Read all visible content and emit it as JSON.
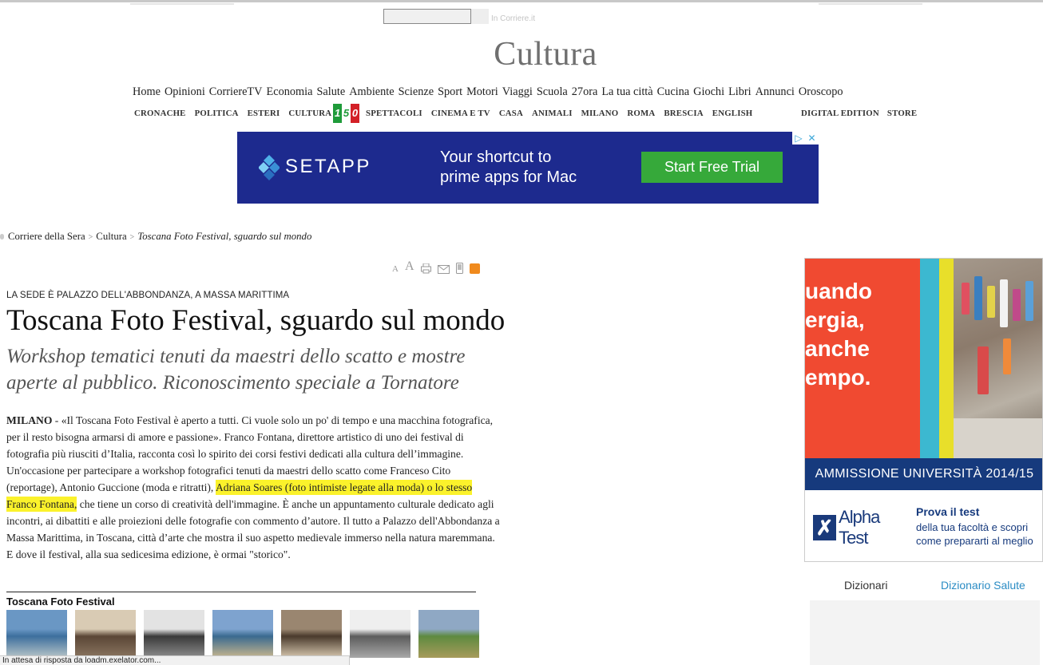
{
  "search": {
    "placeholder": "In Corriere.it"
  },
  "section": {
    "title": "Cultura"
  },
  "main_nav": [
    "Home",
    "Opinioni",
    "CorriereTV",
    "Economia",
    "Salute",
    "Ambiente",
    "Scienze",
    "Sport",
    "Motori",
    "Viaggi",
    "Scuola",
    "27ora",
    "La tua città",
    "Cucina",
    "Giochi",
    "Libri",
    "Annunci",
    "Oroscopo"
  ],
  "sub_nav": {
    "left": [
      "CRONACHE",
      "POLITICA",
      "ESTERI",
      "CULTURA"
    ],
    "badge": "150",
    "badge_colors": [
      "#1f9b3a",
      "#ffffff",
      "#d32027"
    ],
    "mid": [
      "SPETTACOLI",
      "CINEMA E TV",
      "CASA",
      "ANIMALI",
      "MILANO",
      "ROMA",
      "BRESCIA",
      "ENGLISH"
    ],
    "right": [
      "DIGITAL EDITION",
      "STORE"
    ]
  },
  "banner_ad": {
    "brand": "SETAPP",
    "text_line1": "Your shortcut to",
    "text_line2": "prime apps for Mac",
    "cta": "Start Free Trial",
    "background": "#1d2a8e",
    "cta_color": "#36a93a"
  },
  "breadcrumb": {
    "home": "Corriere della Sera",
    "section": "Cultura",
    "current": "Toscana Foto Festival, sguardo sul mondo"
  },
  "article_tools": [
    "font-smaller-icon",
    "font-larger-icon",
    "print-icon",
    "email-icon",
    "mobile-icon",
    "rss-icon"
  ],
  "article": {
    "kicker": "LA SEDE È PALAZZO DELL'ABBONDANZA, A MASSA MARITTIMA",
    "headline": "Toscana Foto Festival, sguardo sul mondo",
    "subhead": "Workshop tematici tenuti da maestri dello scatto e mostre aperte al pubblico. Riconoscimento speciale a Tornatore",
    "dateline": "MILANO",
    "body_before": " - «Il Toscana Foto Festival è aperto a tutti. Ci vuole solo un po' di tempo e una macchina fotografica, per il resto bisogna armarsi di amore e passione». Franco Fontana, direttore artistico di uno dei festival di fotografia più riusciti d’Italia, racconta così lo spirito dei corsi festivi dedicati alla cultura dell’immagine. Un'occasione per partecipare a workshop fotografici tenuti da maestri dello scatto come Franceso Cito (reportage), Antonio Guccione (moda e ritratti), ",
    "body_highlight": "Adriana Soares (foto intimiste legate alla moda) o lo stesso Franco Fontana,",
    "body_after": " che tiene un corso di creatività dell'immagine. È anche un appuntamento culturale dedicato agli incontri, ai dibattiti e alle proiezioni delle fotografie con commento d’autore. Il tutto a Palazzo dell'Abbondanza a Massa Marittima, in Toscana, città d’arte che mostra il suo aspetto medievale immerso nella natura maremmana. E dove il festival, alla sua sedicesima edizione, è ormai \"storico\".",
    "highlight_color": "#fbf22b"
  },
  "gallery": {
    "title": "Toscana Foto Festival",
    "thumbs": [
      {
        "name": "island-aerial",
        "colors": [
          "#6a97c4",
          "#3d6f9d",
          "#b9c6c8"
        ]
      },
      {
        "name": "tower-sepia",
        "colors": [
          "#d9cbb4",
          "#5a4636",
          "#8a7560"
        ]
      },
      {
        "name": "portrait-bw",
        "colors": [
          "#e3e3e3",
          "#3a3a3a",
          "#8e8e8e"
        ]
      },
      {
        "name": "coast-landscape",
        "colors": [
          "#7ea3cf",
          "#3a6a8f",
          "#c9b78e"
        ]
      },
      {
        "name": "book-pages",
        "colors": [
          "#9a8670",
          "#4a3a2c",
          "#d7c8b0"
        ]
      },
      {
        "name": "children-bw",
        "colors": [
          "#efefef",
          "#5c5c5c",
          "#a8a8a8"
        ]
      },
      {
        "name": "hills-green",
        "colors": [
          "#8fa8c4",
          "#5e8a3f",
          "#a79b5b"
        ]
      }
    ]
  },
  "status_bar": {
    "text": "In attesa di risposta da loadm.exelator.com..."
  },
  "side_ad": {
    "headline_lines": [
      "uando",
      "ergia,",
      "anche",
      "empo."
    ],
    "band": "AMMISSIONE UNIVERSITÀ 2014/15",
    "logo_text": "Alpha Test",
    "cta_title": "Prova il test",
    "cta_text": "della tua facoltà e scopri come prepararti al meglio",
    "background": "#f04a31",
    "band_color": "#163a7d"
  },
  "dictionaries": {
    "tab1": "Dizionari",
    "tab2": "Dizionario Salute"
  }
}
